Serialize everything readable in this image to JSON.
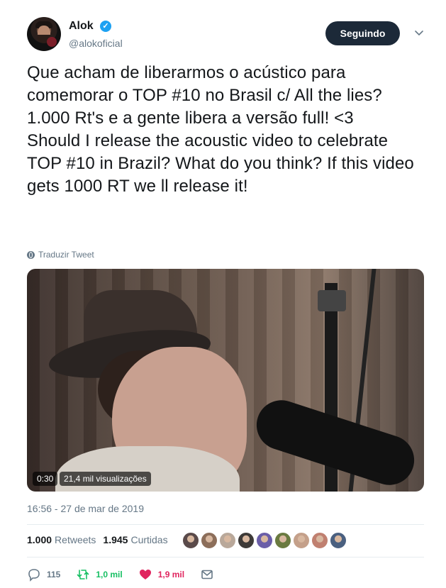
{
  "author": {
    "name": "Alok",
    "handle": "@alokoficial",
    "verified": true
  },
  "follow_button": "Seguindo",
  "tweet": {
    "text_pt": "Que acham de liberarmos o acústico para comemorar o TOP #10 no Brasil c/ All the lies? 1.000 Rt's e a gente libera a versão full! <3",
    "text_en": "Should I release the acoustic video to celebrate TOP #10 in Brazil? What do you think? If this video gets 1000 RT we ll release it!"
  },
  "translate_label": "Traduzir Tweet",
  "video": {
    "duration": "0:30",
    "views": "21,4 mil visualizações"
  },
  "timestamp": "16:56 - 27 de mar de 2019",
  "stats": {
    "retweets_value": "1.000",
    "retweets_label": "Retweets",
    "likes_value": "1.945",
    "likes_label": "Curtidas"
  },
  "liker_avatar_colors": [
    "#5a4a4a",
    "#8c6e5a",
    "#b9a89a",
    "#3d3a38",
    "#6b5ea8",
    "#6a7a40",
    "#c4a08a",
    "#c08070",
    "#4a6080"
  ],
  "actions": {
    "reply_count": "115",
    "retweet_count": "1,0 mil",
    "like_count": "1,9 mil"
  },
  "colors": {
    "accent": "#1da1f2",
    "button_bg": "#1c2938",
    "retweet": "#17bf63",
    "like": "#e0245e",
    "muted": "#657786"
  }
}
